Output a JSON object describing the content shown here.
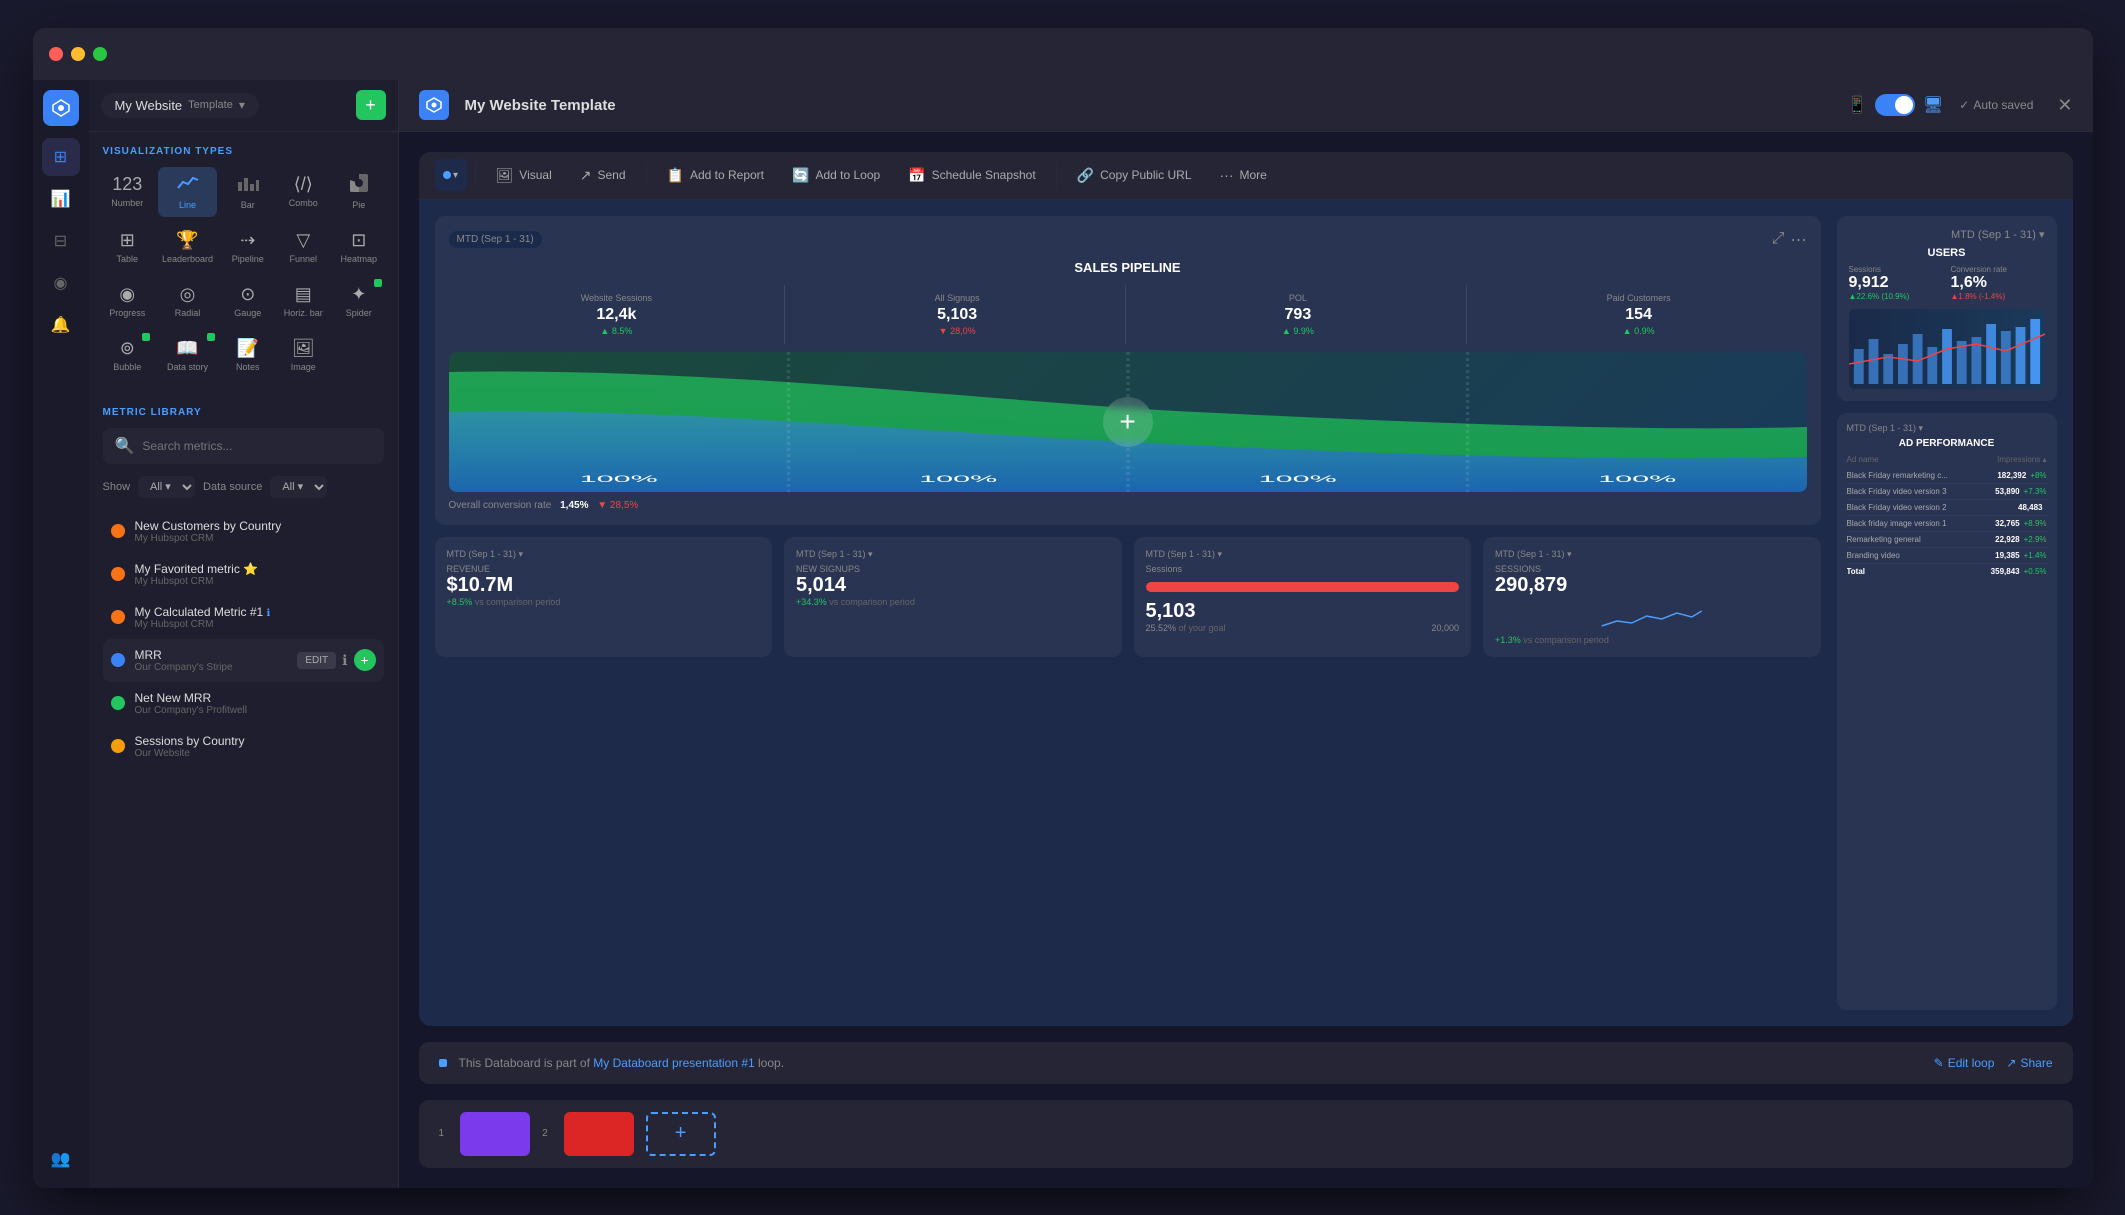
{
  "window": {
    "title": "My Website",
    "subtitle": "Template",
    "auto_saved": "Auto saved"
  },
  "left_panel": {
    "section_title": "VISUALIZATION TYPES",
    "viz_types": [
      {
        "id": "number",
        "label": "Number",
        "icon": "123"
      },
      {
        "id": "line",
        "label": "Line",
        "icon": "📈",
        "active": true
      },
      {
        "id": "bar",
        "label": "Bar",
        "icon": "📊"
      },
      {
        "id": "combo",
        "label": "Combo",
        "icon": "🔀"
      },
      {
        "id": "pie",
        "label": "Pie",
        "icon": "🥧"
      },
      {
        "id": "table",
        "label": "Table",
        "icon": "⊞"
      },
      {
        "id": "leaderboard",
        "label": "Leaderboard",
        "icon": "🏆"
      },
      {
        "id": "pipeline",
        "label": "Pipeline",
        "icon": "⇢"
      },
      {
        "id": "funnel",
        "label": "Funnel",
        "icon": "⬇"
      },
      {
        "id": "heatmap",
        "label": "Heatmap",
        "icon": "🌡"
      },
      {
        "id": "progress",
        "label": "Progress",
        "icon": "◉"
      },
      {
        "id": "radial",
        "label": "Radial",
        "icon": "◎"
      },
      {
        "id": "gauge",
        "label": "Gauge",
        "icon": "⊙"
      },
      {
        "id": "horiz_bar",
        "label": "Horiz. bar",
        "icon": "▤"
      },
      {
        "id": "spider",
        "label": "Spider",
        "icon": "✦"
      },
      {
        "id": "bubble",
        "label": "Bubble",
        "icon": "⊚"
      },
      {
        "id": "data_story",
        "label": "Data story",
        "icon": "📖"
      },
      {
        "id": "notes",
        "label": "Notes",
        "icon": "📝"
      },
      {
        "id": "image",
        "label": "Image",
        "icon": "🖼"
      }
    ],
    "metric_section_title": "METRIC LIBRARY",
    "search_placeholder": "Search metrics...",
    "filter_show_label": "Show",
    "filter_show_value": "All",
    "filter_source_label": "Data source",
    "filter_source_value": "All",
    "metrics": [
      {
        "id": "new-customers",
        "name": "New Customers by Country",
        "source": "My Hubspot CRM",
        "color": "#f97316"
      },
      {
        "id": "my-favorited",
        "name": "My Favorited metric ⭐",
        "source": "My Hubspot CRM",
        "color": "#f97316"
      },
      {
        "id": "calculated",
        "name": "My Calculated Metric #1",
        "source": "My Hubspot CRM",
        "color": "#f97316"
      },
      {
        "id": "mrr",
        "name": "MRR",
        "source": "Our Company's Stripe",
        "color": "#3b82f6",
        "active": true,
        "edit": "EDIT"
      },
      {
        "id": "net-new-mrr",
        "name": "Net New MRR",
        "source": "Our Company's Profitwell",
        "color": "#22c55e"
      },
      {
        "id": "sessions-by-country",
        "name": "Sessions by Country",
        "source": "Our Website",
        "color": "#f59e0b"
      }
    ]
  },
  "toolbar": {
    "visual_label": "Visual",
    "send_label": "Send",
    "add_to_report_label": "Add to Report",
    "add_to_loop_label": "Add to Loop",
    "schedule_snapshot_label": "Schedule Snapshot",
    "copy_public_url_label": "Copy Public URL",
    "more_label": "More"
  },
  "sales_pipeline": {
    "date_range": "MTD (Sep 1 - 31)",
    "title": "SALES PIPELINE",
    "metrics": [
      {
        "label": "Website Sessions",
        "value": "12,4k",
        "change": "+8.5%",
        "positive": true
      },
      {
        "label": "All Signups",
        "value": "5,103",
        "change": "▼ 28,0%",
        "positive": false
      },
      {
        "label": "POL",
        "value": "793",
        "change": "+9.9%",
        "positive": true
      },
      {
        "label": "Paid Customers",
        "value": "154",
        "change": "+0.9%",
        "positive": true
      }
    ],
    "conversion_label": "Overall conversion rate",
    "conversion_rate": "1,45%",
    "conversion_change": "▼ 28,5%"
  },
  "users_widget": {
    "date_range": "MTD (Sep 1 - 31)",
    "title": "USERS",
    "sessions_label": "Sessions",
    "sessions_value": "9,912",
    "sessions_change": "+22.6%",
    "conversion_label": "Conversion rate",
    "conversion_value": "1,6%",
    "conversion_change": "+1.8%"
  },
  "bottom_widgets": [
    {
      "date_range": "MTD (Sep 1 - 31)",
      "label": "REVENUE",
      "value": "$10.7M",
      "change": "+8.5%",
      "vs": "vs comparison period"
    },
    {
      "date_range": "MTD (Sep 1 - 31)",
      "label": "NEW SIGNUPS",
      "value": "5,014",
      "change": "+34.3%",
      "vs": "vs comparison period"
    },
    {
      "date_range": "MTD (Sep 1 - 31)",
      "label": "Sessions",
      "type": "progress",
      "value": "5,103",
      "goal": "20,000",
      "goal_pct": "25.52%"
    },
    {
      "date_range": "MTD (Sep 1 - 31)",
      "label": "SESSIONS",
      "value": "290,879",
      "change": "+1.3%",
      "sparkline": true
    }
  ],
  "ad_performance": {
    "date_range": "MTD (Sep 1 - 31)",
    "title": "AD PERFORMANCE",
    "rows": [
      {
        "name": "Black Friday remarketing c...",
        "value": "182,392",
        "change": "+8%",
        "positive": true
      },
      {
        "name": "Black Friday video version 3",
        "value": "53,890",
        "change": "+7.3%",
        "positive": true
      },
      {
        "name": "Black Friday video version 2",
        "value": "48,483",
        "change": "",
        "positive": false
      },
      {
        "name": "Black friday image version 1",
        "value": "32,765",
        "change": "+8.9%",
        "positive": true
      },
      {
        "name": "Remarketing general",
        "value": "22,928",
        "change": "+2.9%",
        "positive": true
      },
      {
        "name": "Branding video",
        "value": "19,385",
        "change": "+1.4%",
        "positive": true
      },
      {
        "name": "Total",
        "value": "359,843",
        "change": "+0.5%",
        "positive": true
      }
    ]
  },
  "loop_bar": {
    "text": "This Databoard is part of",
    "link_text": "My Databoard presentation #1",
    "suffix": "loop.",
    "edit_label": "Edit loop",
    "share_label": "Share"
  },
  "slides": [
    {
      "num": "1",
      "color": "#7c3aed"
    },
    {
      "num": "2",
      "color": "#dc2626"
    }
  ],
  "nav_icons": [
    {
      "id": "dashboard",
      "icon": "⊞"
    },
    {
      "id": "chart",
      "icon": "📊"
    },
    {
      "id": "table",
      "icon": "⊟"
    },
    {
      "id": "gauge",
      "icon": "◉"
    },
    {
      "id": "alert",
      "icon": "🔔"
    },
    {
      "id": "users",
      "icon": "👥"
    }
  ]
}
